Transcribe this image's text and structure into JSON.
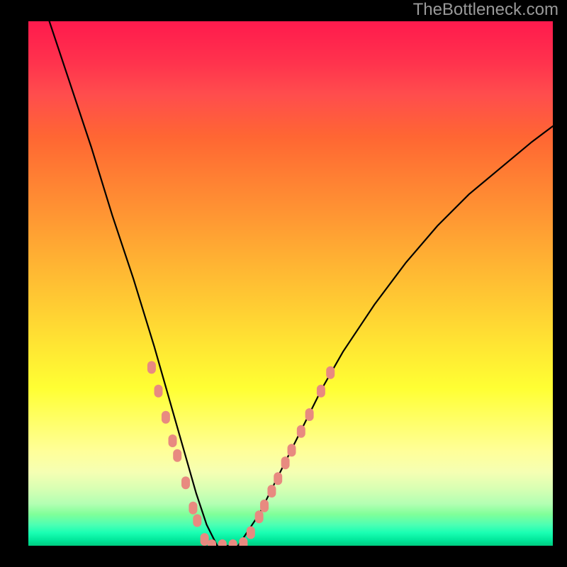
{
  "watermark": "TheBottleneck.com",
  "chart_data": {
    "type": "line",
    "title": "",
    "xlabel": "",
    "ylabel": "",
    "xlim": [
      0,
      1
    ],
    "ylim": [
      0,
      1
    ],
    "grid": false,
    "legend": false,
    "series": [
      {
        "name": "curve",
        "description": "V-shaped bottleneck curve",
        "x": [
          0.04,
          0.08,
          0.12,
          0.16,
          0.2,
          0.24,
          0.28,
          0.3,
          0.32,
          0.34,
          0.36,
          0.4,
          0.44,
          0.48,
          0.52,
          0.56,
          0.6,
          0.66,
          0.72,
          0.78,
          0.84,
          0.9,
          0.96,
          1.0
        ],
        "y": [
          1.0,
          0.88,
          0.76,
          0.63,
          0.51,
          0.38,
          0.24,
          0.17,
          0.1,
          0.04,
          0.0,
          0.0,
          0.06,
          0.14,
          0.22,
          0.3,
          0.37,
          0.46,
          0.54,
          0.61,
          0.67,
          0.72,
          0.77,
          0.8
        ]
      }
    ],
    "markers": {
      "name": "highlighted-points",
      "description": "Salmon-colored rounded markers near bottom of V",
      "points": [
        {
          "x": 0.235,
          "y": 0.34
        },
        {
          "x": 0.248,
          "y": 0.295
        },
        {
          "x": 0.262,
          "y": 0.245
        },
        {
          "x": 0.275,
          "y": 0.2
        },
        {
          "x": 0.284,
          "y": 0.172
        },
        {
          "x": 0.3,
          "y": 0.12
        },
        {
          "x": 0.314,
          "y": 0.072
        },
        {
          "x": 0.322,
          "y": 0.048
        },
        {
          "x": 0.336,
          "y": 0.012
        },
        {
          "x": 0.35,
          "y": 0.0
        },
        {
          "x": 0.37,
          "y": 0.0
        },
        {
          "x": 0.39,
          "y": 0.0
        },
        {
          "x": 0.41,
          "y": 0.004
        },
        {
          "x": 0.424,
          "y": 0.025
        },
        {
          "x": 0.44,
          "y": 0.055
        },
        {
          "x": 0.45,
          "y": 0.076
        },
        {
          "x": 0.464,
          "y": 0.104
        },
        {
          "x": 0.476,
          "y": 0.128
        },
        {
          "x": 0.49,
          "y": 0.158
        },
        {
          "x": 0.502,
          "y": 0.182
        },
        {
          "x": 0.52,
          "y": 0.218
        },
        {
          "x": 0.536,
          "y": 0.25
        },
        {
          "x": 0.558,
          "y": 0.295
        },
        {
          "x": 0.576,
          "y": 0.33
        }
      ]
    },
    "background": {
      "gradient": [
        {
          "pos": 0.0,
          "color": "#ff1a4d"
        },
        {
          "pos": 0.3,
          "color": "#ff9933"
        },
        {
          "pos": 0.6,
          "color": "#ffe633"
        },
        {
          "pos": 0.85,
          "color": "#f5ffb3"
        },
        {
          "pos": 1.0,
          "color": "#00cc80"
        }
      ]
    }
  }
}
